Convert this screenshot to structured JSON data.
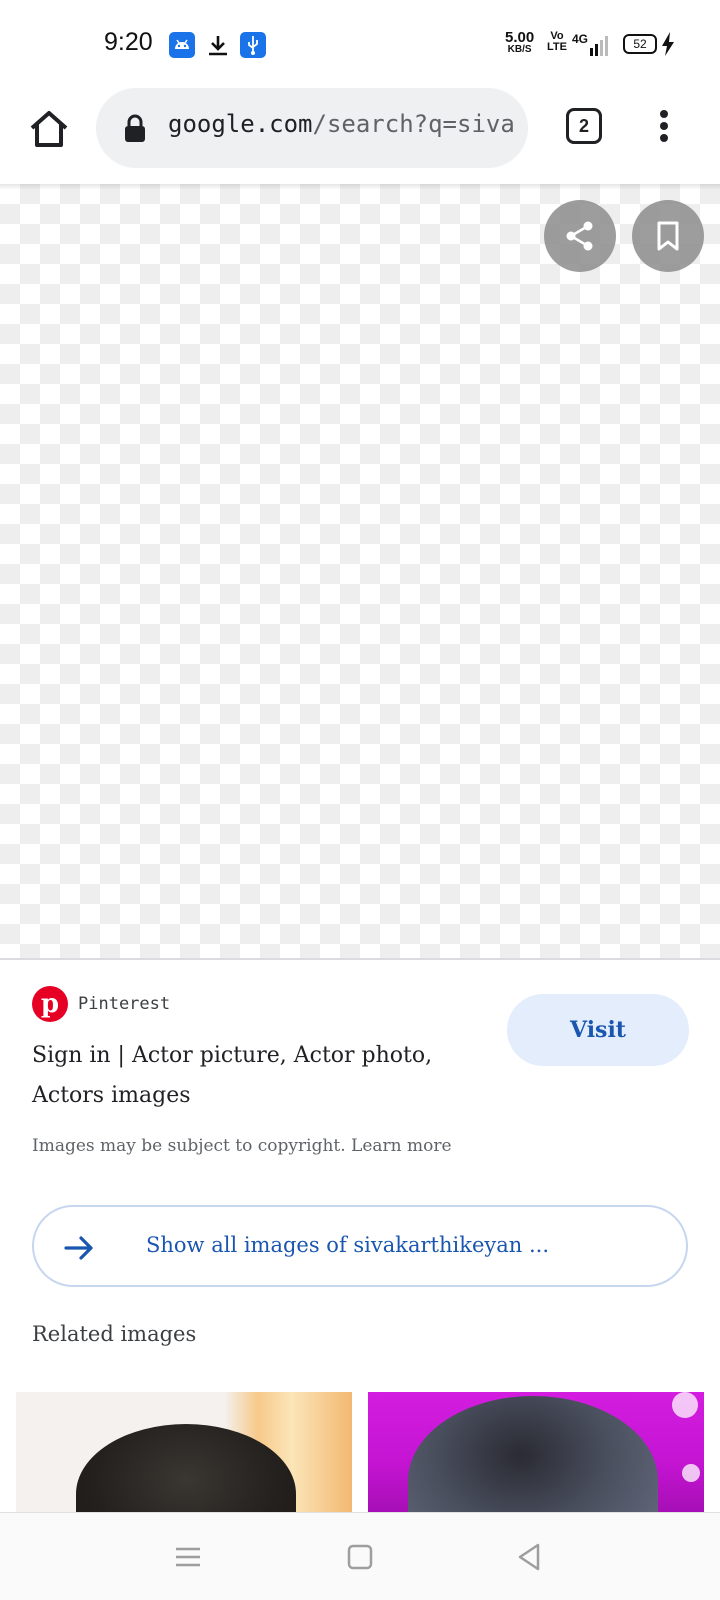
{
  "status_bar": {
    "time": "9:20",
    "net_speed_value": "5.00",
    "net_speed_unit": "KB/S",
    "volte_top": "Vo",
    "volte_bottom": "LTE",
    "network": "4G",
    "battery": "52",
    "icons": [
      "android-icon",
      "download-icon",
      "usb-icon",
      "signal-icon",
      "battery-icon",
      "charging-icon"
    ]
  },
  "browser": {
    "url_host": "google.com",
    "url_path": "/search?q=sivak",
    "tab_count": "2",
    "accent_color": "#1a73e8"
  },
  "viewer": {
    "share_icon": "share-icon",
    "save_icon": "bookmark-icon"
  },
  "result": {
    "source_logo": "p",
    "source_name": "Pinterest",
    "title": "Sign in | Actor picture, Actor photo, Actors images",
    "visit_label": "Visit",
    "copyright_text": "Images may be subject to copyright.",
    "learn_more": "Learn more",
    "show_all_label": "Show all images of sivakarthikeyan ...",
    "related_heading": "Related images",
    "brand_color": "#e60023",
    "link_color": "#1a56b0"
  },
  "nav_bar": {
    "icons": [
      "menu-icon",
      "square-home-icon",
      "back-triangle-icon"
    ]
  }
}
